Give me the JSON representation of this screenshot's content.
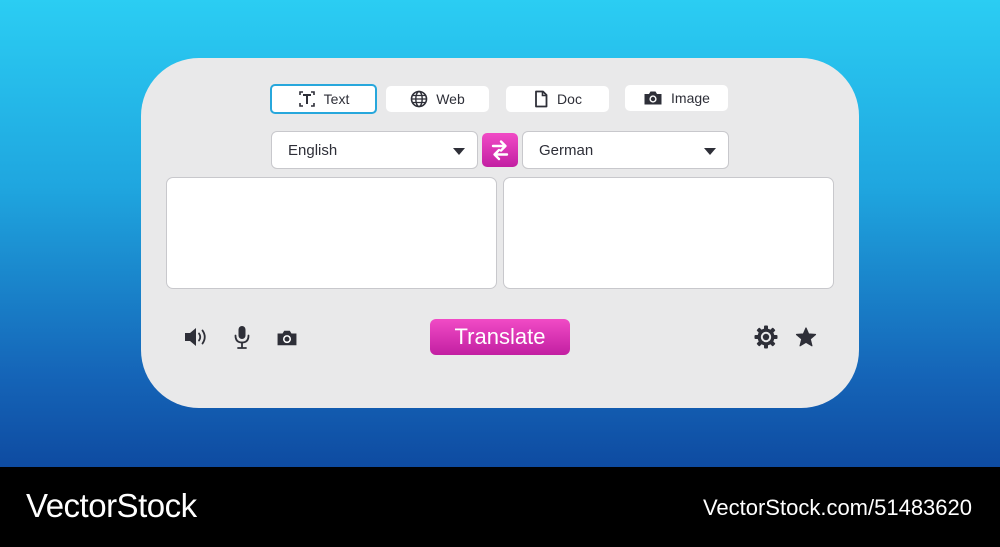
{
  "tabs": [
    {
      "label": "Text",
      "icon": "text-icon",
      "active": true
    },
    {
      "label": "Web",
      "icon": "globe-icon",
      "active": false
    },
    {
      "label": "Doc",
      "icon": "document-icon",
      "active": false
    },
    {
      "label": "Image",
      "icon": "camera-icon",
      "active": false
    }
  ],
  "source_language": {
    "selected": "English"
  },
  "target_language": {
    "selected": "German"
  },
  "source_text": {
    "value": ""
  },
  "target_text": {
    "value": ""
  },
  "translate_label": "Translate",
  "toolbar_left": [
    "speaker-icon",
    "microphone-icon",
    "camera-icon"
  ],
  "toolbar_right": [
    "gear-icon",
    "star-icon"
  ],
  "colors": {
    "accent": "#d22fb3",
    "active_tab_border": "#27a7dc",
    "panel": "#e9e9ea"
  },
  "watermark": {
    "brand": "VectorStock",
    "ref": "VectorStock.com/51483620"
  }
}
